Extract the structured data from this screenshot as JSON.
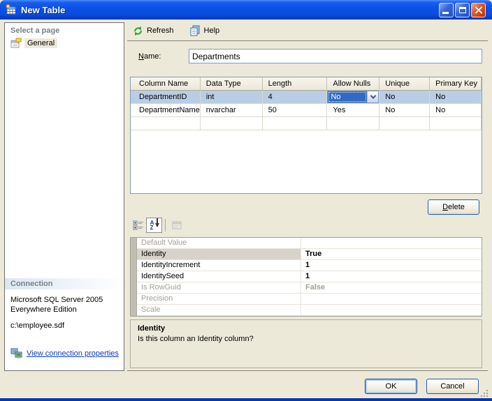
{
  "window": {
    "title": "New Table"
  },
  "sidebar": {
    "header": "Select a page",
    "items": [
      {
        "label": "General"
      }
    ],
    "connection": {
      "header": "Connection",
      "server": "Microsoft SQL Server 2005 Everywhere Edition",
      "file": "c:\\employee.sdf",
      "link": "View connection properties"
    }
  },
  "toolbar": {
    "refresh": "Refresh",
    "help": "Help"
  },
  "form": {
    "name_label": "Name:",
    "name_value": "Departments"
  },
  "columns_grid": {
    "headers": [
      "Column Name",
      "Data Type",
      "Length",
      "Allow Nulls",
      "Unique",
      "Primary Key"
    ],
    "rows": [
      {
        "column_name": "DepartmentID",
        "data_type": "int",
        "length": "4",
        "allow_nulls": "No",
        "unique": "No",
        "primary_key": "No"
      },
      {
        "column_name": "DepartmentName",
        "data_type": "nvarchar",
        "length": "50",
        "allow_nulls": "Yes",
        "unique": "No",
        "primary_key": "No"
      }
    ],
    "delete_label": "Delete"
  },
  "property_grid": {
    "rows": [
      {
        "name": "Default Value",
        "value": "",
        "state": "disabled"
      },
      {
        "name": "Identity",
        "value": "True",
        "state": "selected"
      },
      {
        "name": "IdentityIncrement",
        "value": "1",
        "state": "normal"
      },
      {
        "name": "IdentitySeed",
        "value": "1",
        "state": "normal"
      },
      {
        "name": "Is RowGuid",
        "value": "False",
        "state": "disabled"
      },
      {
        "name": "Precision",
        "value": "",
        "state": "disabled"
      },
      {
        "name": "Scale",
        "value": "",
        "state": "disabled"
      }
    ]
  },
  "description": {
    "title": "Identity",
    "text": "Is this column an Identity column?"
  },
  "footer": {
    "ok": "OK",
    "cancel": "Cancel"
  },
  "icons": {
    "app": "table-icon",
    "minimize": "minimize-icon",
    "maximize": "maximize-icon",
    "close": "close-icon",
    "refresh": "refresh-icon",
    "help": "help-icon",
    "general": "general-page-icon",
    "connection_link": "computers-icon",
    "categorized": "categorized-icon",
    "alphabetical": "alphabetical-sort-icon",
    "property_pages": "property-pages-icon",
    "combo": "chevron-down-icon",
    "resize": "resize-grip"
  },
  "colors": {
    "titlebar_blue": "#0b51e6",
    "dialog_bg": "#ece9d8",
    "selection_blue": "#316ac5",
    "selected_row": "#b9cde5",
    "link_blue": "#0b3cc2",
    "grid_border": "#7f9db9"
  }
}
